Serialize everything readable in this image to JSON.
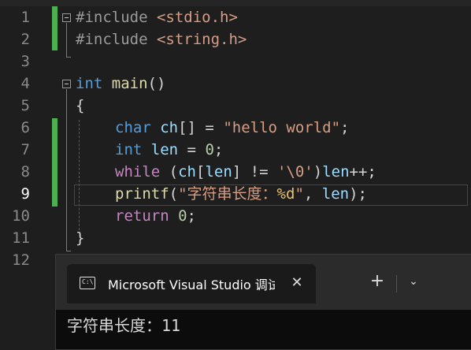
{
  "editor": {
    "line_numbers": [
      "1",
      "2",
      "3",
      "4",
      "5",
      "6",
      "7",
      "8",
      "9",
      "10",
      "11",
      "12"
    ],
    "active_line": "9",
    "lines": {
      "l1": {
        "pre": "#include",
        "sp": " ",
        "str": "<stdio.h>"
      },
      "l2": {
        "pre": "#include",
        "sp": " ",
        "str": "<string.h>"
      },
      "l4": {
        "kw": "int",
        "sp": " ",
        "fn": "main",
        "p": "()"
      },
      "l5": {
        "p": "{"
      },
      "l6": {
        "kw": "char",
        "sp": " ",
        "id": "ch",
        "p1": "[] = ",
        "str": "\"hello world\"",
        "p2": ";"
      },
      "l7": {
        "kw": "int",
        "sp": " ",
        "id": "len",
        "p1": " = ",
        "num": "0",
        "p2": ";"
      },
      "l8": {
        "kw": "while",
        "p1": " (",
        "id1": "ch",
        "p2": "[",
        "id2": "len",
        "p3": "] != ",
        "str": "'\\0'",
        "p4": ")",
        "id3": "len",
        "p5": "++;"
      },
      "l9": {
        "fn": "printf",
        "p1": "(",
        "str1": "\"字符串长度：",
        "fmt": "%d",
        "str2": "\"",
        "p2": ", ",
        "id": "len",
        "p3": ");"
      },
      "l10": {
        "kw": "return",
        "sp": " ",
        "num": "0",
        "p": ";"
      },
      "l11": {
        "p": "}"
      }
    }
  },
  "terminal": {
    "tab_title": "Microsoft Visual Studio 调试控制台",
    "tab_icon": "C:\\",
    "close_glyph": "✕",
    "new_tab_glyph": "+",
    "dropdown_glyph": "⌄",
    "output": "字符串长度：11"
  }
}
